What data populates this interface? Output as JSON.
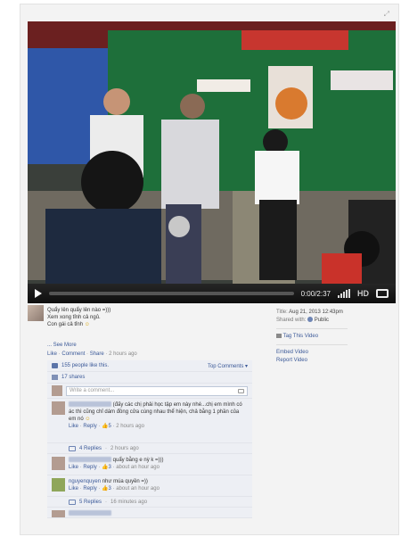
{
  "video": {
    "time": "0:00/2:37",
    "hd_label": "HD"
  },
  "post": {
    "lines": [
      "Quẩy lên quẩy lên nào =)))",
      "Xem xong tỉnh cả ngủ.",
      "Con gái cả tỉnh"
    ],
    "see_more": "... See More",
    "like": "Like",
    "comment": "Comment",
    "share": "Share",
    "time": "2 hours ago"
  },
  "ufi": {
    "likes": "155 people like this.",
    "top_comments": "Top Comments ▾",
    "shares": "17 shares",
    "write_placeholder": "Write a comment..."
  },
  "comments": [
    {
      "text": "(đấy các chị phải học tập em này nhé...chị em mình có ác thì cũng chỉ dám đồng cửa cùng nhau thể hiện, chả bằng 1 phần của em nó",
      "like": "Like",
      "reply": "Reply",
      "likes": "5",
      "time": "2 hours ago",
      "replies": "4 Replies",
      "replies_time": "2 hours ago"
    },
    {
      "text": "quẩy bằng e nỳ k =)))",
      "like": "Like",
      "reply": "Reply",
      "likes": "3",
      "time": "about an hour ago"
    },
    {
      "name": "nguyenquyen",
      "text": "như múa quyền =))",
      "like": "Like",
      "reply": "Reply",
      "likes": "3",
      "time": "about an hour ago",
      "replies": "5 Replies",
      "replies_time": "16 minutes ago"
    }
  ],
  "meta": {
    "title_label": "Title:",
    "title_value": "Aug 21, 2013 12:43pm",
    "shared_label": "Shared with:",
    "shared_value": "Public",
    "tag": "Tag This Video",
    "embed": "Embed Video",
    "report": "Report Video"
  }
}
